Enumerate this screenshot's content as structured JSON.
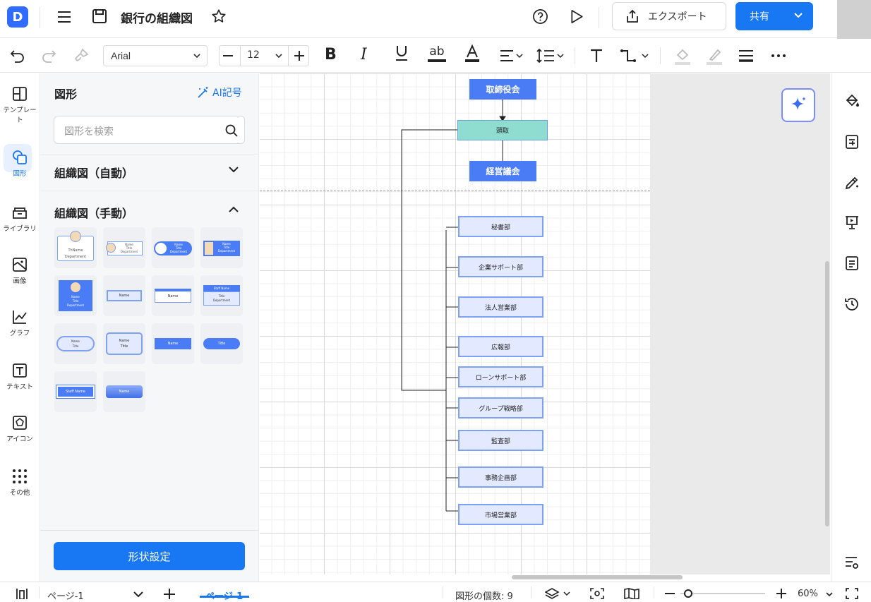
{
  "app": {
    "logo_letter": "D",
    "doc_title": "銀行の組織図"
  },
  "header": {
    "export_label": "エクスポート",
    "share_label": "共有"
  },
  "toolbar": {
    "font_name": "Arial",
    "font_size": "12",
    "strike_label": "ab"
  },
  "rail": {
    "items": [
      {
        "label": "テンプレート"
      },
      {
        "label": "図形"
      },
      {
        "label": "ライブラリ"
      },
      {
        "label": "画像"
      },
      {
        "label": "グラフ"
      },
      {
        "label": "テキスト"
      },
      {
        "label": "アイコン"
      },
      {
        "label": "その他"
      }
    ]
  },
  "panel": {
    "title": "図形",
    "ai_label": "AI記号",
    "search_placeholder": "図形を検索",
    "section_auto": "組織図（自動）",
    "section_manual": "組織図（手動）",
    "shape_settings_label": "形状設定",
    "tiles": [
      {
        "lines": [
          "ThName",
          "Department"
        ]
      },
      {
        "lines": [
          "Name",
          "Title",
          "Department"
        ]
      },
      {
        "lines": [
          "Name",
          "Title",
          "Department"
        ]
      },
      {
        "lines": [
          "Name",
          "Title",
          "Department"
        ]
      },
      {
        "lines": [
          "Name",
          "Title",
          "Department"
        ]
      },
      {
        "lines": [
          "Name"
        ]
      },
      {
        "lines": [
          "Name"
        ]
      },
      {
        "lines": [
          "Staff Name",
          "Title",
          "Department"
        ]
      },
      {
        "lines": [
          "Name",
          "Title"
        ]
      },
      {
        "lines": [
          "Name",
          "Title"
        ]
      },
      {
        "lines": [
          "Name"
        ]
      },
      {
        "lines": [
          "Title"
        ]
      },
      {
        "lines": [
          "Staff Name"
        ]
      },
      {
        "lines": [
          "Name"
        ]
      }
    ]
  },
  "chart": {
    "board": "取締役会",
    "president": "頭取",
    "committee": "経営議会",
    "departments": [
      "秘書部",
      "企業サポート部",
      "法人営業部",
      "広報部",
      "ローンサポート部",
      "グループ戦略部",
      "監査部",
      "事務企画部",
      "市場営業部"
    ]
  },
  "status": {
    "page_selector": "ページ-1",
    "page_tab": "ページ-1",
    "shape_count": "図形の個数: 9",
    "zoom": "60%"
  },
  "colors": {
    "accent": "#1877f2",
    "node_blue": "#4a7cf6",
    "node_teal": "#8fddd0",
    "dept_fill": "#e3eaff",
    "dept_border": "#7fa1f3"
  }
}
